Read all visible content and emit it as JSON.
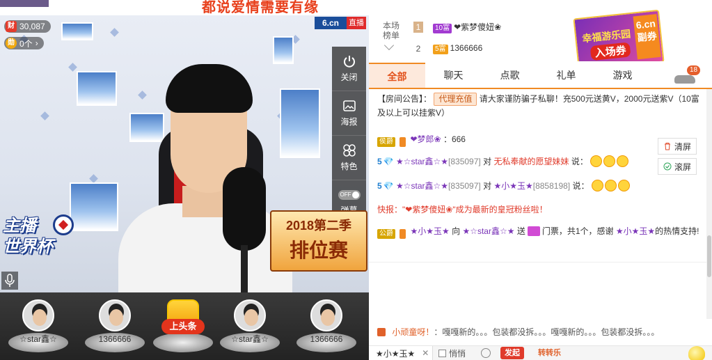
{
  "banner": {
    "title": "都说爱情需要有缘"
  },
  "video": {
    "brand": "6.cn",
    "live_label": "直播",
    "stats": {
      "wealth_icon": "财",
      "wealth_value": "30,087",
      "gift_icon": "勋",
      "gift_count": "0个"
    },
    "tools": [
      {
        "icon": "power-icon",
        "label": "关闭"
      },
      {
        "icon": "poster-icon",
        "label": "海报"
      },
      {
        "icon": "color-icon",
        "label": "特色"
      },
      {
        "icon": "toggle-icon",
        "label": "弹幕",
        "toggle_text": "OFF"
      }
    ],
    "worldcup": {
      "line1": "主播",
      "line2": "世界杯"
    },
    "season": {
      "line1": "2018第二季",
      "line2": "排位赛"
    }
  },
  "seats": [
    {
      "name": "☆star鑫☆",
      "type": "avatar"
    },
    {
      "name": "1366666",
      "type": "avatar"
    },
    {
      "name": "上头条",
      "type": "hot"
    },
    {
      "name": "☆star鑫☆",
      "type": "avatar"
    },
    {
      "name": "1366666",
      "type": "avatar"
    }
  ],
  "rank": {
    "title": "本场榜单",
    "rows": [
      {
        "num": "1",
        "badge": "10富",
        "name": "❤紫梦傻妞❀"
      },
      {
        "num": "2",
        "badge": "5富",
        "name": "1366666"
      }
    ]
  },
  "promo": {
    "line1": "幸福游乐园",
    "line2": "入场券",
    "brand": "6.cn",
    "line3": "副券"
  },
  "tabs": [
    "全部",
    "聊天",
    "点歌",
    "礼单",
    "游戏"
  ],
  "car_count": "18",
  "chat": {
    "notice_prefix": "【房间公告】：",
    "notice_tag": "代理充值",
    "notice_text": "请大家谨防骗子私聊！充500元送黄V，2000元送紫V（10富及以上可以挂紫V）",
    "line1": {
      "badge": "侯爵",
      "name": "❤梦郎❀",
      "text": "：666"
    },
    "line2": {
      "level": "5",
      "name": "★☆star鑫☆★",
      "uid": "[835097]",
      "to": "对",
      "target": "无私奉献的愿望妹妹",
      "say": "说："
    },
    "line3": {
      "level": "5",
      "name": "★☆star鑫☆★",
      "uid": "[835097]",
      "to": "对",
      "target": "★小★玉★",
      "target_uid": "[8858198]",
      "say": "说："
    },
    "quick": {
      "prefix": "快报：",
      "text": "\"❤紫梦傻妞❀\"成为最新的皇冠粉丝啦！"
    },
    "gift": {
      "badge": "公爵",
      "name": "★小★玉★",
      "to": "向",
      "target": "★☆star鑫☆★",
      "send": "送",
      "item": "门票，共1个，感谢",
      "thank": "★小★玉★",
      "tail": "的热情支持!"
    },
    "btn_clear": "清屏",
    "btn_scroll": "滚屏"
  },
  "ticker": {
    "name": "小顽童呀！",
    "text": "：嘎嘎新的。。。包装都没拆。。。嘎嘎新的。。。包装都没拆。。。"
  },
  "input": {
    "to_user": "★小★玉★",
    "whisper": "悄悄",
    "btn1": "发起",
    "btn2": "转转乐"
  }
}
